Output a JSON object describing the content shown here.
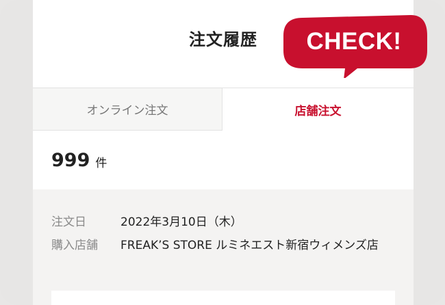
{
  "header": {
    "title": "注文履歴"
  },
  "badge": {
    "label": "CHECK!",
    "color": "#c8102e"
  },
  "tabs": [
    {
      "label": "オンライン注文",
      "active": false
    },
    {
      "label": "店舗注文",
      "active": true
    }
  ],
  "count": {
    "value": "999",
    "unit": "件"
  },
  "order": {
    "date_label": "注文日",
    "date_value": "2022年3月10日（木）",
    "store_label": "購入店舗",
    "store_value": "FREAK’S STORE ルミネエスト新宿ウィメンズ店"
  },
  "colors": {
    "accent": "#c8102e",
    "inactive_tab_bg": "#f6f6f5",
    "section_bg": "#f4f3f2"
  }
}
